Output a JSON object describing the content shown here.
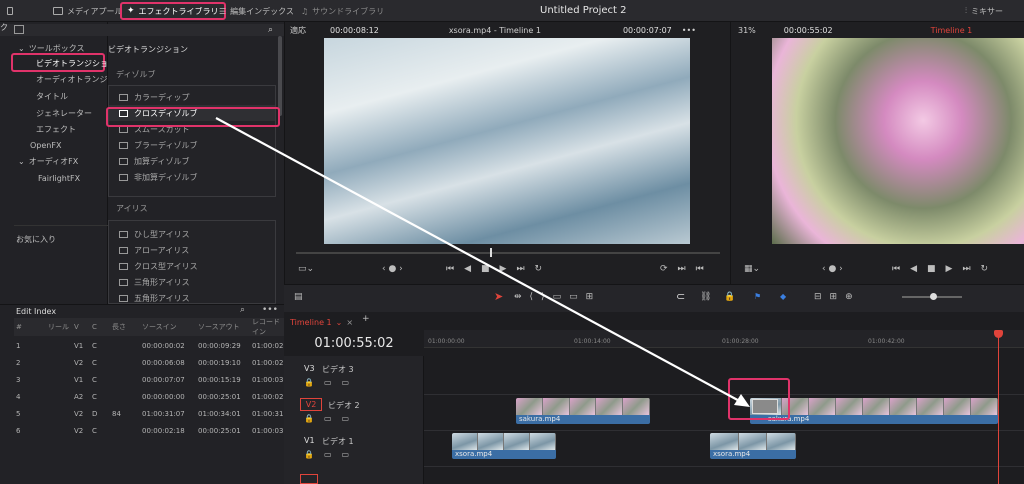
{
  "toolbar": {
    "media_pool": "メディアプール",
    "effects_library": "エフェクトライブラリ",
    "edit_index": "編集インデックス",
    "sound_library": "サウンドライブラリ",
    "project_title": "Untitled Project 2",
    "mixer": "ミキサー"
  },
  "sidebar": {
    "cut_label": "ク",
    "toolbox": "ツールボックス",
    "video_transitions": "ビデオトランジション",
    "audio_transitions": "オーディオトランジ...",
    "titles": "タイトル",
    "generators": "ジェネレーター",
    "effects": "エフェクト",
    "openfx": "OpenFX",
    "audio_fx": "オーディオFX",
    "fairlight_fx": "FairlightFX",
    "favorites": "お気に入り"
  },
  "effects_panel": {
    "title": "ビデオトランジション",
    "dissolve_header": "ディゾルブ",
    "dissolve_items": [
      "カラーディップ",
      "クロスディゾルブ",
      "スムースカット",
      "ブラーディゾルブ",
      "加算ディゾルブ",
      "非加算ディゾルブ"
    ],
    "iris_header": "アイリス",
    "iris_items": [
      "ひし型アイリス",
      "アローアイリス",
      "クロス型アイリス",
      "三角形アイリス",
      "五角形アイリス"
    ]
  },
  "source_viewer": {
    "zoom": "適応",
    "timecode": "00:00:08:12",
    "clip_title": "xsora.mp4 - Timeline 1",
    "duration": "00:00:07:07"
  },
  "program_viewer": {
    "zoom": "31%",
    "timecode": "00:00:55:02",
    "timeline": "Timeline 1"
  },
  "edit_index": {
    "title": "Edit Index",
    "columns": [
      "#",
      "リール",
      "V",
      "C",
      "長さ",
      "ソースイン",
      "ソースアウト",
      "レコードイン"
    ],
    "rows": [
      [
        "1",
        "",
        "V1",
        "C",
        "",
        "00:00:00:02",
        "00:00:09:29",
        "01:00:02"
      ],
      [
        "2",
        "",
        "V2",
        "C",
        "",
        "00:00:06:08",
        "00:00:19:10",
        "01:00:02"
      ],
      [
        "3",
        "",
        "V1",
        "C",
        "",
        "00:00:07:07",
        "00:00:15:19",
        "01:00:03"
      ],
      [
        "4",
        "",
        "A2",
        "C",
        "",
        "00:00:00:00",
        "00:00:25:01",
        "01:00:02"
      ],
      [
        "5",
        "",
        "V2",
        "D",
        "84",
        "01:00:31:07",
        "01:00:34:01",
        "01:00:31"
      ],
      [
        "6",
        "",
        "V2",
        "C",
        "",
        "00:00:02:18",
        "00:00:25:01",
        "01:00:03"
      ]
    ]
  },
  "timeline": {
    "tab": "Timeline 1",
    "timecode": "01:00:55:02",
    "ruler": [
      "01:00:00:00",
      "01:00:14:00",
      "01:00:28:00",
      "01:00:42:00"
    ],
    "tracks": [
      {
        "id": "V3",
        "name": "ビデオ 3"
      },
      {
        "id": "V2",
        "name": "ビデオ 2"
      },
      {
        "id": "V1",
        "name": "ビデオ 1"
      }
    ],
    "clips": {
      "v2_a": "sakura.mp4",
      "v2_b": "sakura.mp4",
      "v1_a": "xsora.mp4",
      "v1_b": "xsora.mp4"
    }
  },
  "colors": {
    "accent": "#e0336a",
    "clip_blue": "#3b6ea5",
    "playhead": "#e0443b"
  }
}
